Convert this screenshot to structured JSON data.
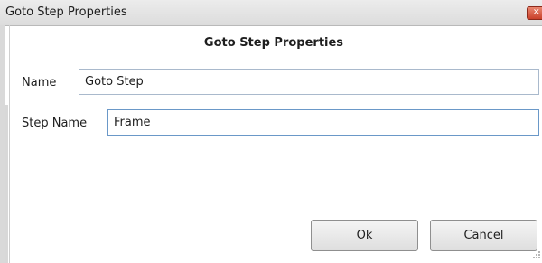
{
  "window": {
    "title": "Goto Step Properties"
  },
  "dialog": {
    "header": "Goto Step Properties",
    "fields": {
      "name_label": "Name",
      "name_value": "Goto Step",
      "step_name_label": "Step Name",
      "step_name_value": "Frame"
    },
    "buttons": {
      "ok_label": "Ok",
      "cancel_label": "Cancel"
    }
  },
  "icons": {
    "close": "close-icon",
    "resize": "resize-grip-icon"
  },
  "colors": {
    "close_button": "#c9402a",
    "focus_border": "#6a98c8"
  }
}
